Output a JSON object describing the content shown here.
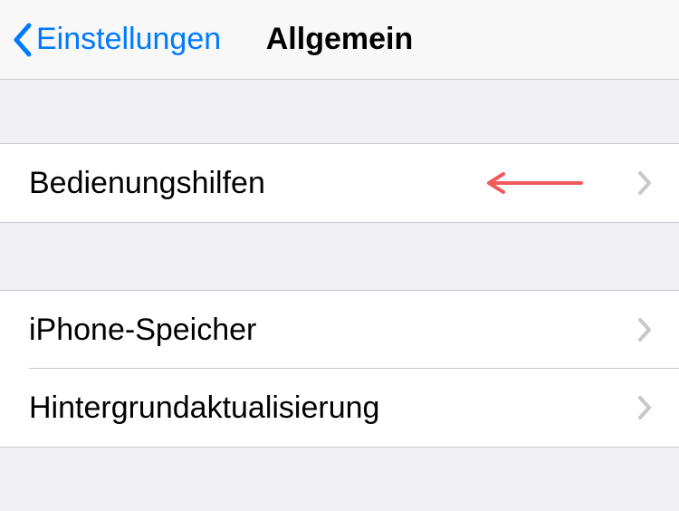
{
  "navbar": {
    "back_label": "Einstellungen",
    "title": "Allgemein"
  },
  "group1": {
    "items": [
      {
        "label": "Bedienungshilfen"
      }
    ]
  },
  "group2": {
    "items": [
      {
        "label": "iPhone-Speicher"
      },
      {
        "label": "Hintergrundaktualisierung"
      }
    ]
  },
  "colors": {
    "tint": "#007aff",
    "annotation": "#ef5b5b",
    "chevron": "#c7c7cc"
  }
}
